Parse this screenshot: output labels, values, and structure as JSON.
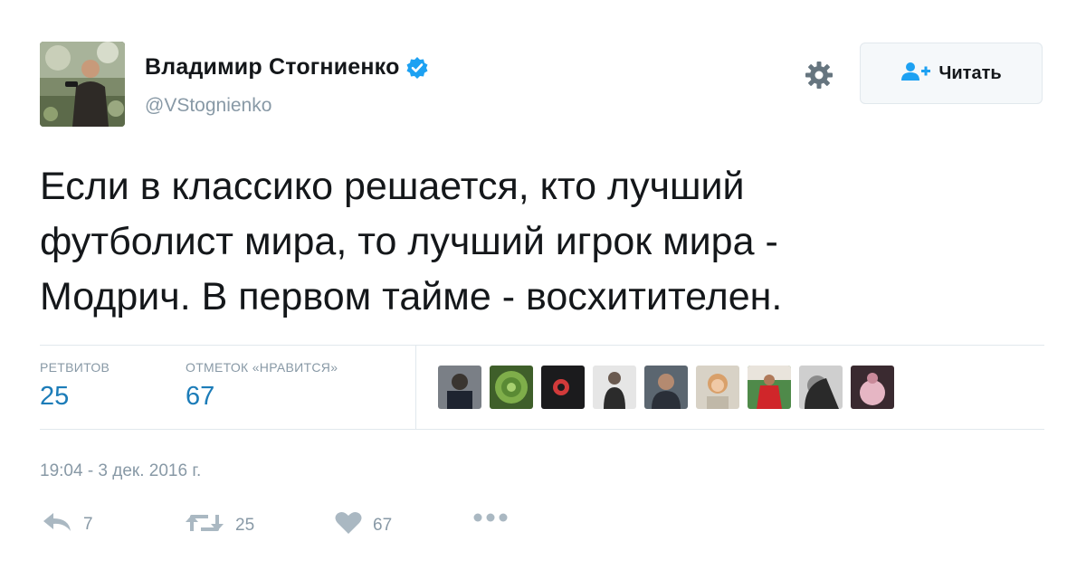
{
  "user": {
    "full_name": "Владимир Стогниенко",
    "handle": "@VStognienko",
    "verified": true
  },
  "follow_button": {
    "label": "Читать",
    "icon": "follow-person-plus-icon"
  },
  "tweet": {
    "lines": [
      "Если в классико решается, кто лучший",
      "футболист мира, то лучший игрок мира -",
      "Модрич. В первом тайме - восхитителен."
    ]
  },
  "stats": {
    "retweets_label": "РЕТВИТОВ",
    "retweets_value": "25",
    "likes_label": "ОТМЕТОК «НРАВИТСЯ»",
    "likes_value": "67"
  },
  "timestamp": "19:04 - 3 дек. 2016 г.",
  "actions": {
    "reply_count": "7",
    "retweet_count": "25",
    "like_count": "67"
  },
  "colors": {
    "link_blue": "#1c7cb8",
    "muted_gray": "#8899a6",
    "verified_blue": "#1da1f2"
  }
}
